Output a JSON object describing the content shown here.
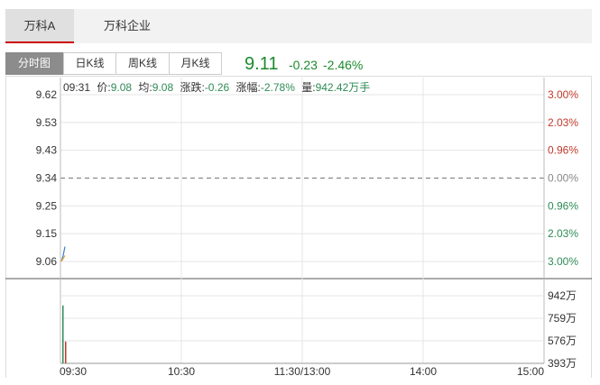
{
  "stock_tabs": [
    {
      "label": "万科A",
      "active": true
    },
    {
      "label": "万科企业",
      "active": false
    }
  ],
  "period_tabs": [
    {
      "label": "分时图",
      "active": true
    },
    {
      "label": "日K线",
      "active": false
    },
    {
      "label": "周K线",
      "active": false
    },
    {
      "label": "月K线",
      "active": false
    }
  ],
  "quote": {
    "price": "9.11",
    "change": "-0.23",
    "change_pct": "-2.46%"
  },
  "info_bar": {
    "time": "09:31",
    "price_label": "价:",
    "price_value": "9.08",
    "avg_label": "均:",
    "avg_value": "9.08",
    "change_label": "涨跌:",
    "change_value": "-0.26",
    "pct_label": "涨幅:",
    "pct_value": "-2.78%",
    "volume_label": "量:",
    "volume_value": "942.42万手"
  },
  "colors": {
    "up": "#c0392b",
    "down": "#2e8b57",
    "quote_down": "#1c8a2e",
    "accent": "#cc0000",
    "price_line": "#3a7bd5",
    "avg_line": "#e0a020"
  },
  "chart_data": {
    "type": "line",
    "title": "",
    "xlabel": "",
    "ylabel": "",
    "x_ticks": [
      "09:30",
      "10:30",
      "11:30/13:00",
      "14:00",
      "15:00"
    ],
    "y_ticks": [
      "9.62",
      "9.53",
      "9.43",
      "9.34",
      "9.25",
      "9.15",
      "9.06"
    ],
    "pct_ticks": [
      "3.00%",
      "2.03%",
      "0.96%",
      "0.00%",
      "0.96%",
      "2.03%",
      "3.00%"
    ],
    "pct_tick_colors": [
      "up",
      "up",
      "up",
      "neutral",
      "down",
      "down",
      "down"
    ],
    "ylim": [
      9.06,
      9.62
    ],
    "prev_close": 9.34,
    "series": [
      {
        "values": [
          9.06,
          9.08,
          9.11
        ]
      },
      {
        "values": [
          9.06,
          9.07,
          9.08
        ]
      }
    ],
    "volume_ticks": [
      "942万",
      "759万",
      "576万",
      "393万"
    ],
    "volume_ylim": [
      393,
      1034
    ],
    "volume_bars": [
      {
        "value": 942,
        "dir": "down"
      },
      {
        "value": 600,
        "dir": "up"
      }
    ]
  }
}
